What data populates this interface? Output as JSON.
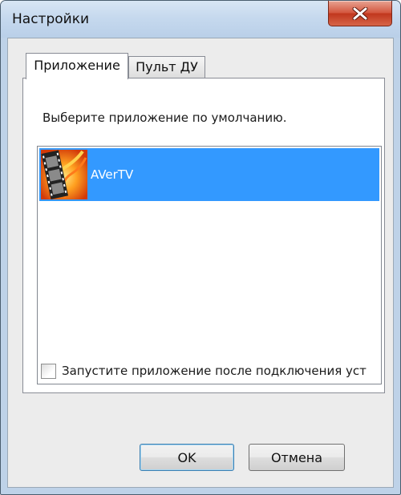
{
  "window": {
    "title": "Настройки"
  },
  "tabs": [
    {
      "label": "Приложение",
      "selected": true
    },
    {
      "label": "Пульт ДУ",
      "selected": false
    }
  ],
  "panel": {
    "prompt": "Выберите приложение по умолчанию.",
    "apps": [
      {
        "label": "AVerTV",
        "icon": "film-strip-app-icon",
        "selected": true
      }
    ],
    "autostart": {
      "label": "Запустите приложение после подключения уст",
      "checked": false
    }
  },
  "buttons": {
    "ok": "OK",
    "cancel": "Отмена"
  },
  "colors": {
    "selection": "#3399ff",
    "close_button": "#c1371d",
    "title_bar": "#c6d9ee",
    "dialog_face": "#ececec"
  }
}
